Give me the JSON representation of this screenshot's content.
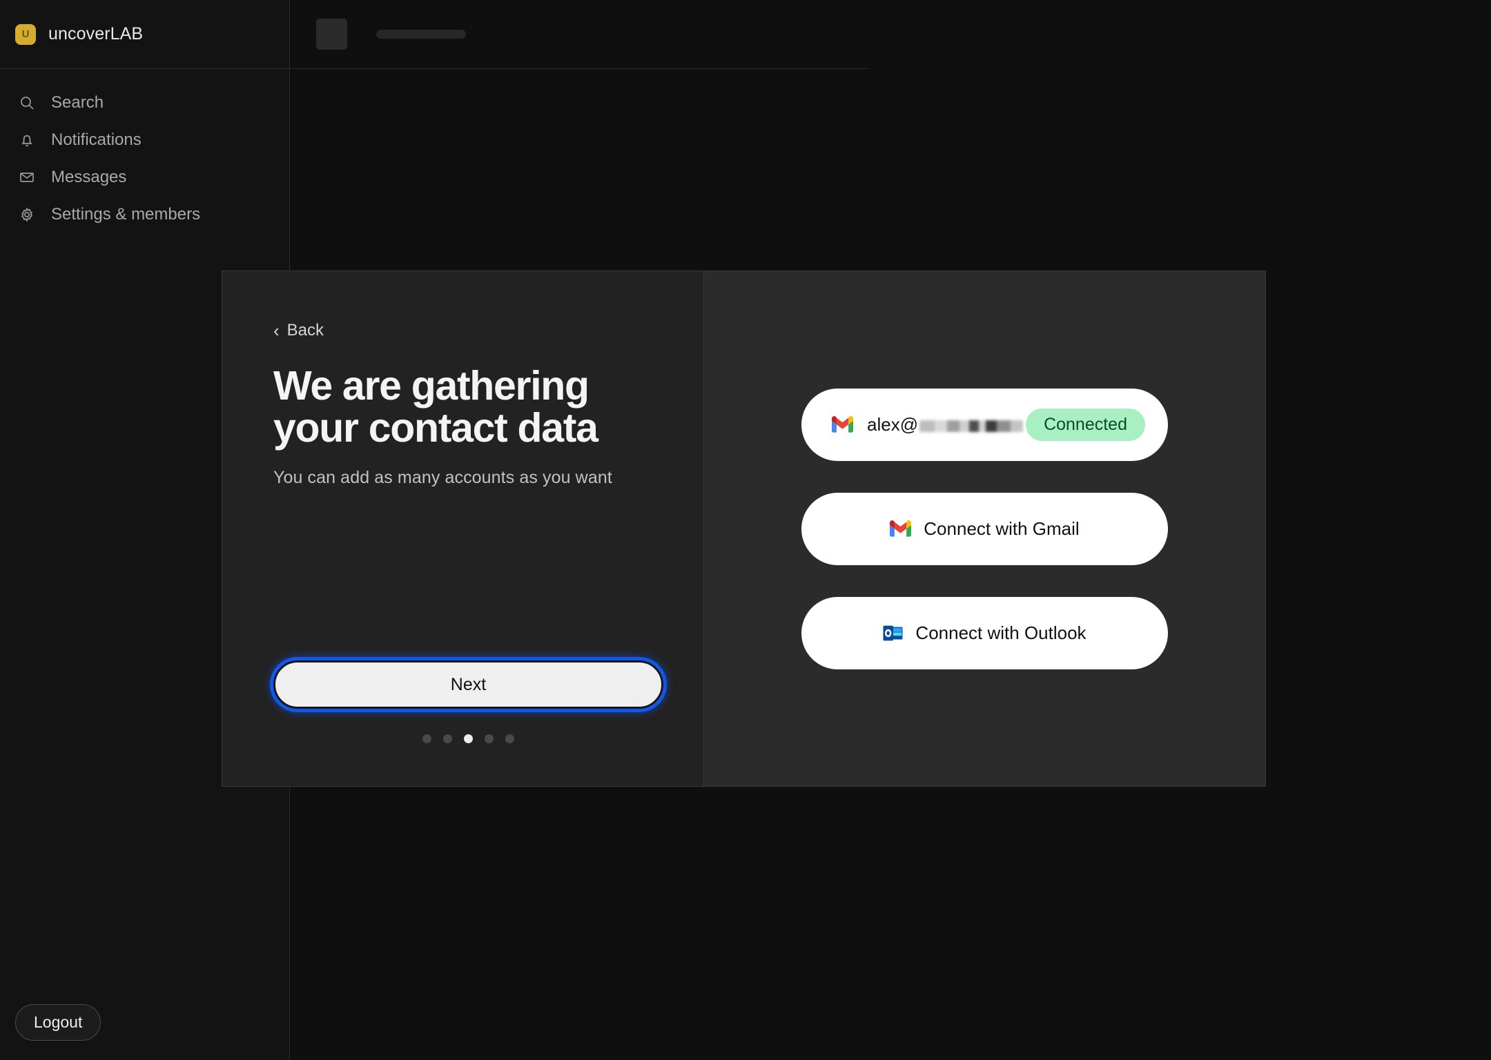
{
  "sidebar": {
    "brand": {
      "badge_letter": "U",
      "name": "uncoverLAB"
    },
    "items": [
      {
        "label": "Search",
        "icon": "search-icon"
      },
      {
        "label": "Notifications",
        "icon": "bell-icon"
      },
      {
        "label": "Messages",
        "icon": "envelope-icon"
      },
      {
        "label": "Settings & members",
        "icon": "gear-icon"
      }
    ],
    "logout_label": "Logout"
  },
  "modal": {
    "back_label": "Back",
    "back_chevron": "‹",
    "headline_line1": "We are gathering",
    "headline_line2": "your contact data",
    "subtitle": "You can add as many accounts as you want",
    "next_label": "Next",
    "pagination": {
      "total": 5,
      "active_index": 3
    },
    "accounts": [
      {
        "provider": "gmail",
        "email_prefix": "alex@",
        "email_domain_redacted": true,
        "status": "Connected",
        "status_bg": "#a8f0c2",
        "status_fg": "#0c4a2a"
      }
    ],
    "connect_buttons": [
      {
        "label": "Connect with Gmail",
        "icon": "gmail-icon"
      },
      {
        "label": "Connect with Outlook",
        "icon": "outlook-icon"
      }
    ]
  },
  "colors": {
    "page_bg": "#0f0f0f",
    "sidebar_bg": "#131313",
    "modal_left_bg": "#222222",
    "modal_right_bg": "#2b2b2b",
    "brand_badge": "#d6ac2e",
    "focus_ring": "#1257ea",
    "next_fill": "#efefef"
  }
}
